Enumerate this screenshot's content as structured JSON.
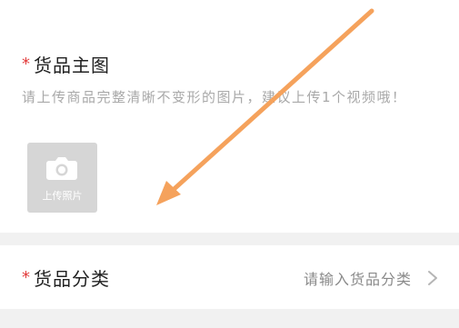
{
  "main_image": {
    "required_mark": "*",
    "title": "货品主图",
    "hint": "请上传商品完整清晰不变形的图片，建议上传1个视频哦！",
    "upload_label": "上传照片",
    "upload_icon": "camera-icon"
  },
  "category": {
    "required_mark": "*",
    "title": "货品分类",
    "placeholder": "请输入货品分类",
    "chevron_icon": "chevron-right-icon"
  },
  "annotation": {
    "arrow_color": "#f5a25c"
  },
  "colors": {
    "required": "#e23b3b",
    "hint": "#a9a9a9",
    "upload_box": "#d6d6d6",
    "divider": "#f1f1f1"
  }
}
